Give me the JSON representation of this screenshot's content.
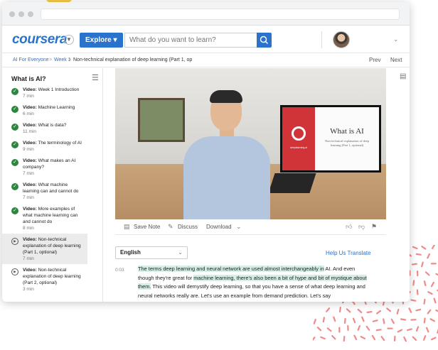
{
  "brand": {
    "logo": "coursera",
    "primary_color": "#2a73cc"
  },
  "nav": {
    "explore_label": "Explore",
    "search_placeholder": "What do you want to learn?"
  },
  "breadcrumb": {
    "items": [
      "AI For Everyone",
      "Week 1",
      "Non-technical explanation of deep learning (Part 1, op"
    ],
    "prev": "Prev",
    "next": "Next"
  },
  "sidebar": {
    "title": "What is AI?",
    "items": [
      {
        "type": "Video:",
        "title": "Week 1 Introduction",
        "time": "7 min",
        "status": "done"
      },
      {
        "type": "Video:",
        "title": "Machine Learning",
        "time": "6 min",
        "status": "done"
      },
      {
        "type": "Video:",
        "title": "What is data?",
        "time": "11 min",
        "status": "done"
      },
      {
        "type": "Video:",
        "title": "The terminology of AI",
        "time": "9 min",
        "status": "done"
      },
      {
        "type": "Video:",
        "title": "What makes an AI company?",
        "time": "7 min",
        "status": "done"
      },
      {
        "type": "Video:",
        "title": "What machine learning can and cannot do",
        "time": "7 min",
        "status": "done"
      },
      {
        "type": "Video:",
        "title": "More examples of what machine learning can and cannot do",
        "time": "8 min",
        "status": "done"
      },
      {
        "type": "Video:",
        "title": "Non-technical explanation of deep learning (Part 1, optional)",
        "time": "7 min",
        "status": "current"
      },
      {
        "type": "Video:",
        "title": "Non-technical explanation of deep learning (Part 2, optional)",
        "time": "3 min",
        "status": "todo"
      }
    ]
  },
  "video": {
    "slide_title": "What is AI",
    "slide_subtitle": "Non-technical explanation of deep learning (Part 1, optional)",
    "slide_logo_text": "deeplearning.ai"
  },
  "video_tools": {
    "save_note": "Save Note",
    "discuss": "Discuss",
    "download": "Download"
  },
  "transcript": {
    "language": "English",
    "help_translate": "Help Us Translate",
    "timestamp": "0:03",
    "seg1": "The terms deep learning and neural network are used almost interchangeably in",
    "seg2": " AI. And even though they're great for ",
    "seg3": "machine learning, there's also been a bit of hype and bit of mystique about them.",
    "seg4": " This video will demystify deep learning, so that you have a sense of what deep learning and neural networks really are. Let's use an example from demand prediction. Let's say"
  }
}
